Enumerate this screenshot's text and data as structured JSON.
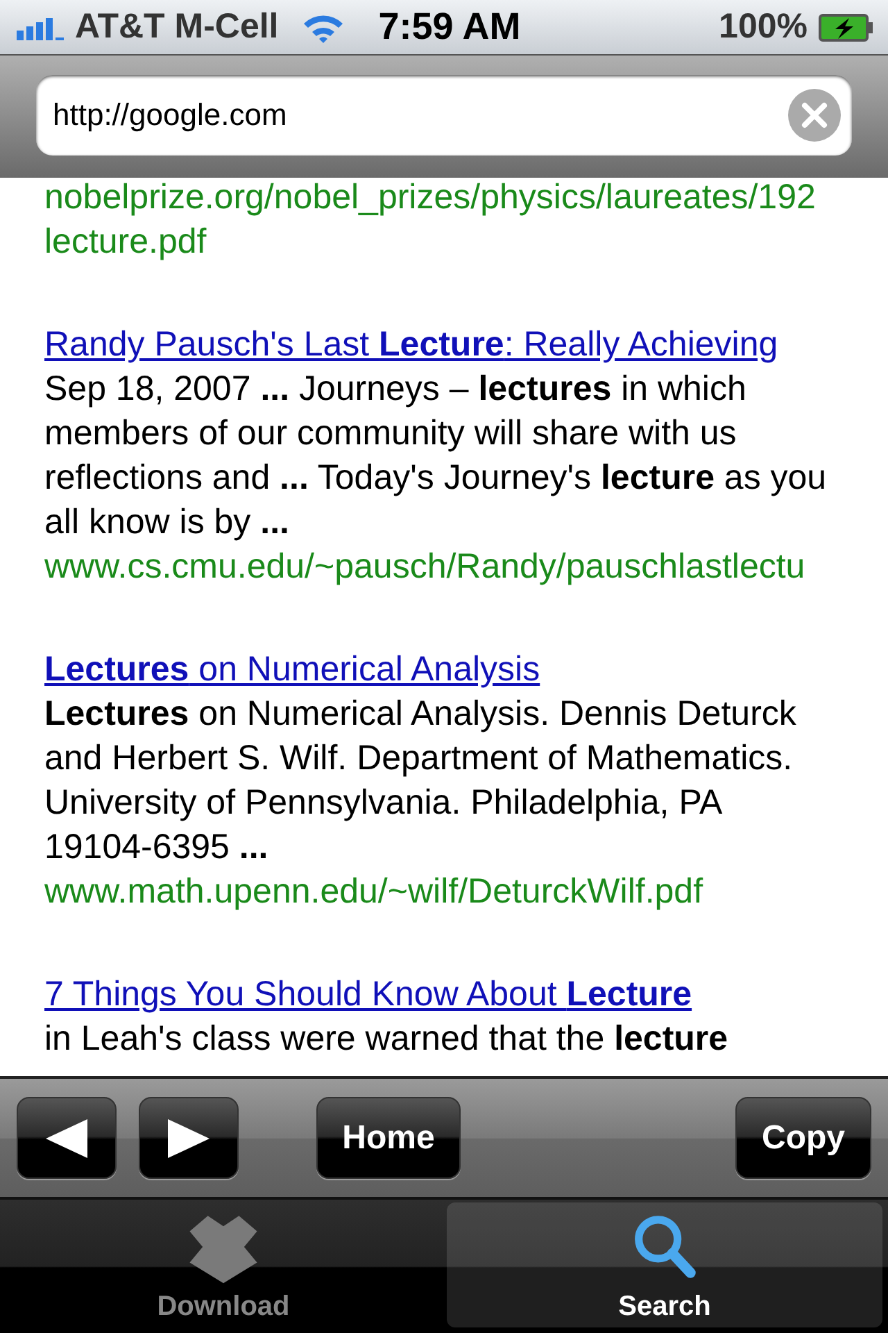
{
  "status_bar": {
    "carrier": "AT&T M-Cell",
    "time": "7:59 AM",
    "battery": "100%"
  },
  "address_bar": {
    "value": "http://google.com"
  },
  "results": [
    {
      "url_lines": [
        "nobelprize.org/nobel_prizes/physics/laureates/192",
        "lecture.pdf"
      ]
    },
    {
      "title": "Randy Pausch's Last **Lecture**: Really Achieving",
      "snippet": "Sep 18, 2007 **...** Journeys – **lectures** in which members of our community will share with us reflections and **...** Today's Journey's **lecture** as you all know is by **...**",
      "url_lines": [
        "www.cs.cmu.edu/~pausch/Randy/pauschlastlectu"
      ]
    },
    {
      "title": "**Lectures** on Numerical Analysis",
      "snippet": "**Lectures** on Numerical Analysis. Dennis Deturck and Herbert S. Wilf. Department of Mathematics. University of Pennsylvania. Philadelphia, PA 19104-6395 **...**",
      "url_lines": [
        "www.math.upenn.edu/~wilf/DeturckWilf.pdf"
      ]
    },
    {
      "title": "7 Things You Should Know About **Lecture**",
      "snippet": "in Leah's class were warned that the **lecture**"
    }
  ],
  "toolbar": [
    {
      "kind": "back"
    },
    {
      "kind": "forward"
    },
    {
      "kind": "text",
      "label": "Home"
    },
    {
      "kind": "text",
      "label": "Copy"
    }
  ],
  "tabs": [
    {
      "label": "Download",
      "selected": false
    },
    {
      "label": "Search",
      "selected": true
    }
  ]
}
